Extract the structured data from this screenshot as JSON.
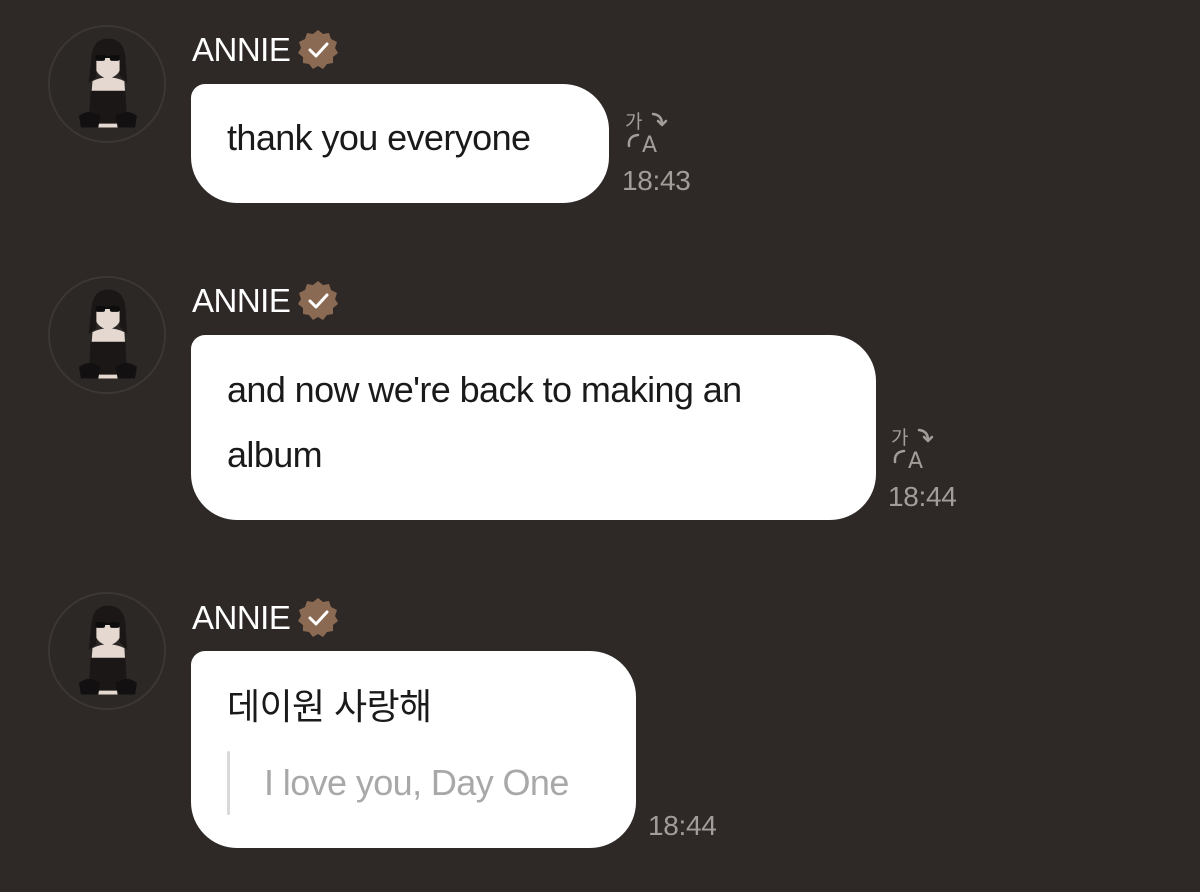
{
  "messages": [
    {
      "sender": "ANNIE",
      "verified_icon": "verified-badge-icon",
      "text": "thank you everyone",
      "translate_icon": "translate-icon",
      "time": "18:43"
    },
    {
      "sender": "ANNIE",
      "verified_icon": "verified-badge-icon",
      "text": "and now we're back to making an\nalbum",
      "translate_icon": "translate-icon",
      "time": "18:44"
    },
    {
      "sender": "ANNIE",
      "verified_icon": "verified-badge-icon",
      "text": "데이원 사랑해",
      "translation": "I love you, Day One",
      "time": "18:44"
    }
  ],
  "colors": {
    "background": "#2e2927",
    "bubble": "#ffffff",
    "badge": "#8a6a52",
    "timestamp": "#a39d99"
  }
}
